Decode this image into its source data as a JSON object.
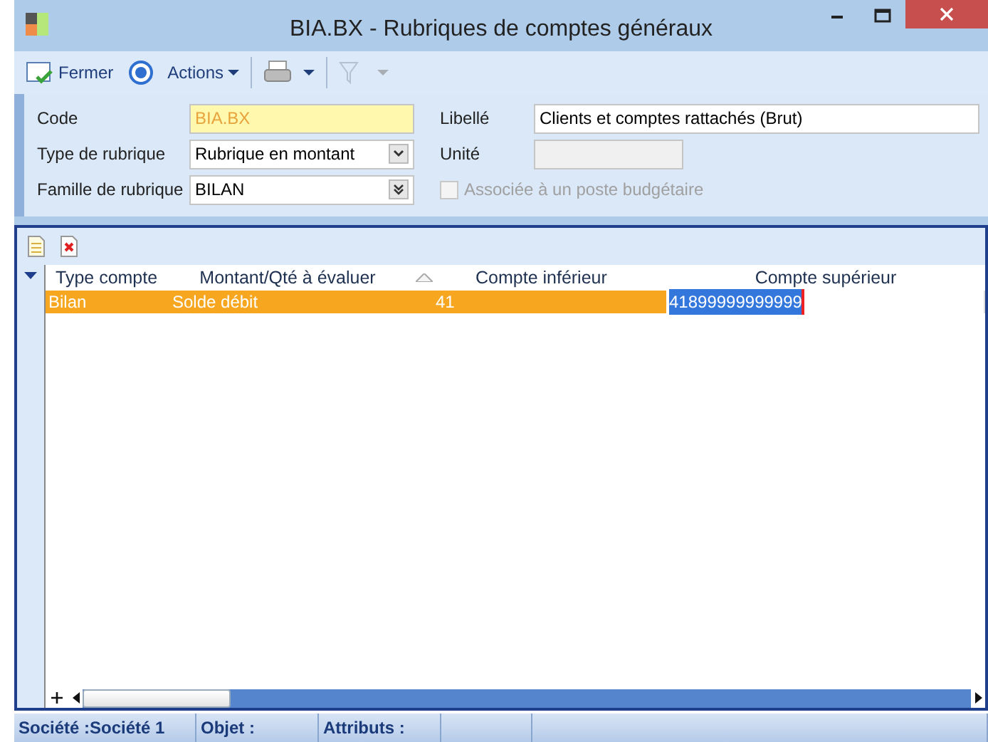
{
  "window": {
    "title": "BIA.BX -  Rubriques de comptes généraux"
  },
  "toolbar": [
    {
      "kind": "close",
      "label": "Fermer"
    },
    {
      "kind": "record"
    },
    {
      "kind": "menu",
      "label": "Actions"
    },
    {
      "kind": "print"
    },
    {
      "kind": "filter",
      "disabled": true
    }
  ],
  "form": {
    "left": [
      {
        "label": "Code",
        "kind": "text",
        "value": "BIA.BX",
        "highlighted": true
      },
      {
        "label": "Type de rubrique",
        "kind": "select",
        "value": "Rubrique en montant"
      },
      {
        "label": "Famille de rubrique",
        "kind": "lookup",
        "value": "BILAN"
      }
    ],
    "right": [
      {
        "label": "Libellé",
        "value": "Clients et comptes rattachés (Brut)"
      },
      {
        "label": "Unité",
        "disabled": true
      }
    ],
    "checkbox": {
      "label": "Associée à un poste budgétaire",
      "checked": false,
      "disabled": true
    }
  },
  "grid": {
    "columns": [
      {
        "label": "Type compte",
        "sorted": false
      },
      {
        "label": "Montant/Qté à évaluer",
        "sorted": false
      },
      {
        "label": "Compte inférieur",
        "sorted": true
      },
      {
        "label": "Compte supérieur",
        "sorted": false
      }
    ],
    "rows": [
      {
        "selected": true,
        "cells": [
          {
            "text": "Bilan"
          },
          {
            "text": "Solde débit"
          },
          {
            "text": "41"
          },
          {
            "text": "41899999999999",
            "editing": true
          }
        ]
      }
    ]
  },
  "status_bar": [
    {
      "text": "Société :Société 1"
    },
    {
      "text": "Objet :"
    },
    {
      "text": "Attributs :"
    }
  ]
}
